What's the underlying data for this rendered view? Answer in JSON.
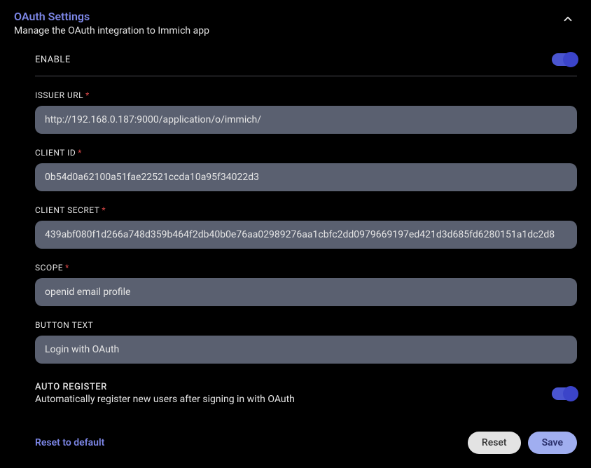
{
  "header": {
    "title": "OAuth Settings",
    "subtitle": "Manage the OAuth integration to Immich app"
  },
  "enable": {
    "label": "ENABLE",
    "value": true
  },
  "fields": {
    "issuer_url": {
      "label": "ISSUER URL",
      "required": true,
      "value": "http://192.168.0.187:9000/application/o/immich/"
    },
    "client_id": {
      "label": "CLIENT ID",
      "required": true,
      "value": "0b54d0a62100a51fae22521ccda10a95f34022d3"
    },
    "client_secret": {
      "label": "CLIENT SECRET",
      "required": true,
      "value": "439abf080f1d266a748d359b464f2db40b0e76aa02989276aa1cbfc2dd0979669197ed421d3d685fd6280151a1dc2d8"
    },
    "scope": {
      "label": "SCOPE",
      "required": true,
      "value": "openid email profile"
    },
    "button_text": {
      "label": "BUTTON TEXT",
      "required": false,
      "value": "Login with OAuth"
    }
  },
  "auto_register": {
    "label": "AUTO REGISTER",
    "description": "Automatically register new users after signing in with OAuth",
    "value": true
  },
  "footer": {
    "reset_default": "Reset to default",
    "reset": "Reset",
    "save": "Save"
  },
  "required_marker": "*"
}
